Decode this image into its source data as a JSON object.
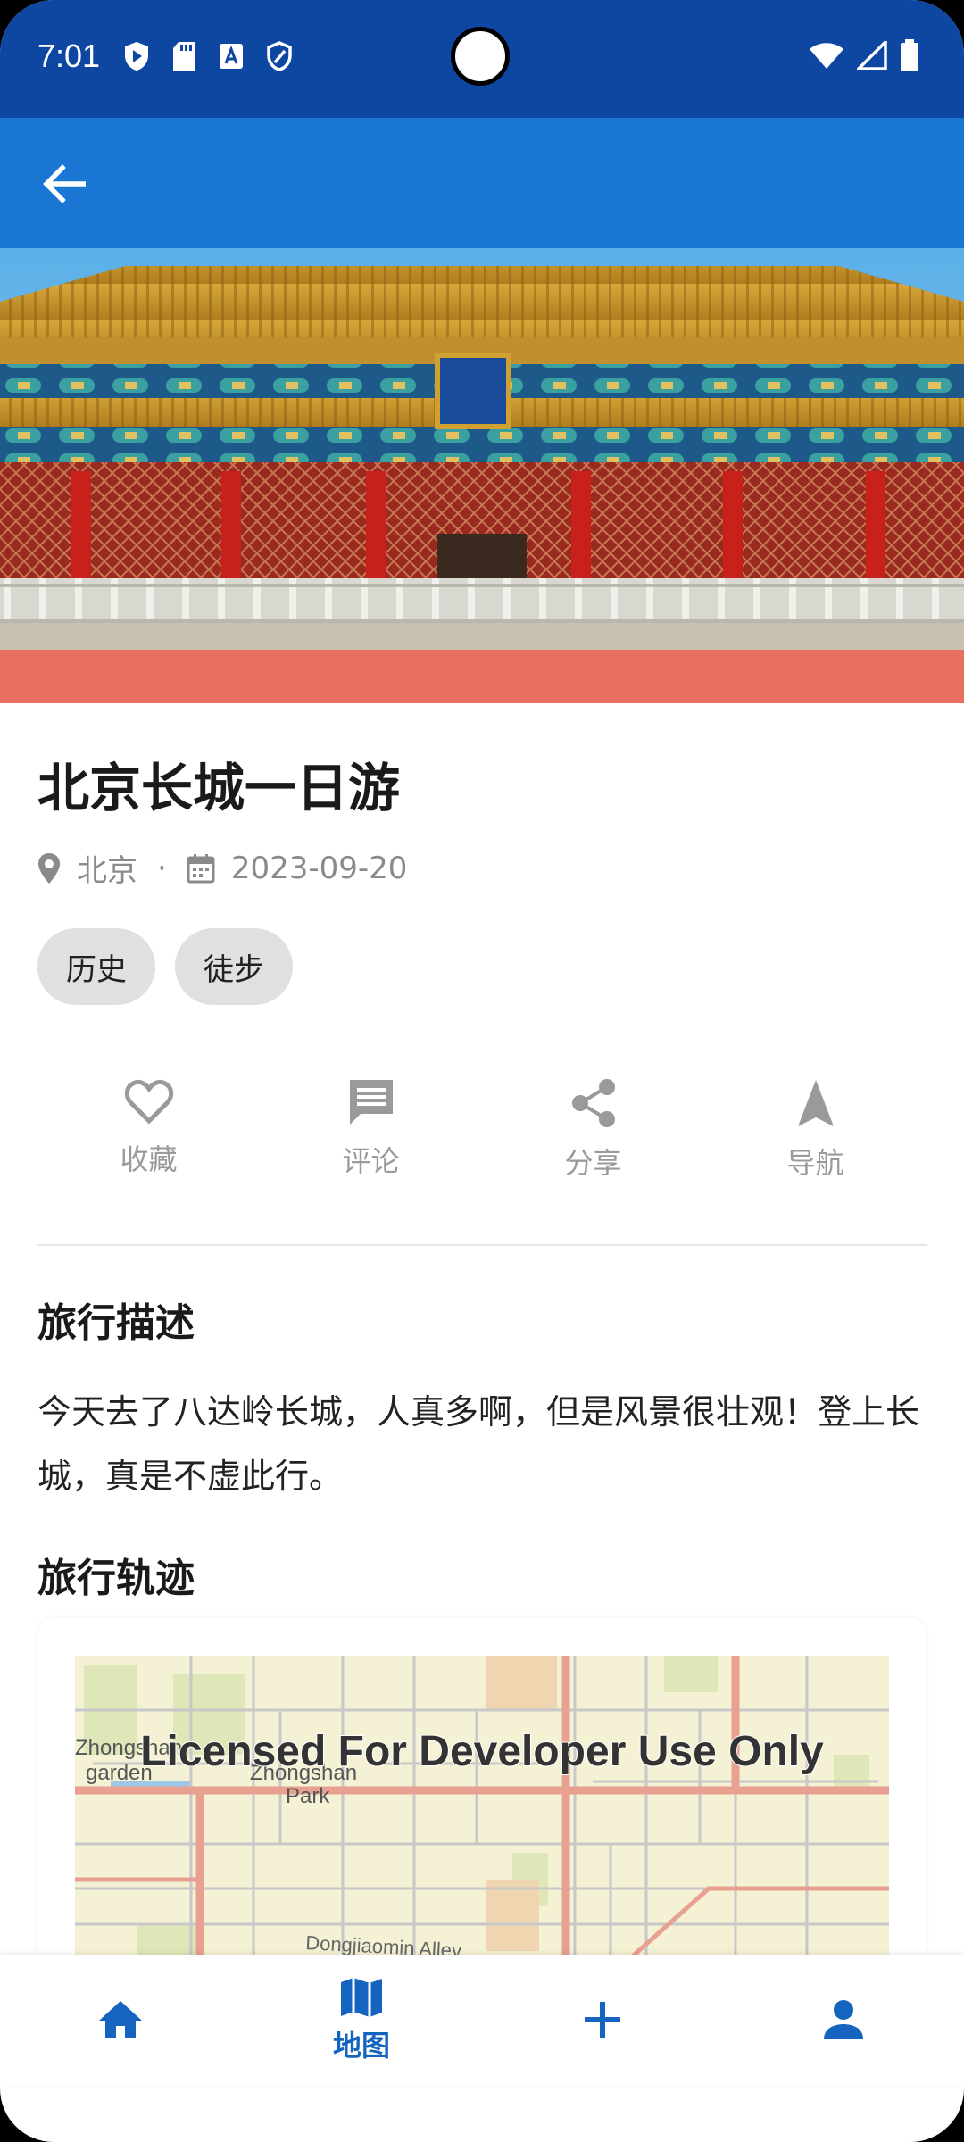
{
  "status_bar": {
    "time": "7:01"
  },
  "app_bar": {
    "back_icon": "arrow-back-icon"
  },
  "hero": {
    "subject": "palace-photo"
  },
  "trip": {
    "title": "北京长城一日游",
    "location": "北京",
    "separator": "·",
    "date": "2023-09-20",
    "tags": [
      "历史",
      "徒步"
    ]
  },
  "actions": [
    {
      "label": "收藏",
      "icon": "heart-icon"
    },
    {
      "label": "评论",
      "icon": "comment-icon"
    },
    {
      "label": "分享",
      "icon": "share-icon"
    },
    {
      "label": "导航",
      "icon": "navigation-icon"
    }
  ],
  "description": {
    "heading": "旅行描述",
    "text": "今天去了八达岭长城，人真多啊，但是风景很壮观！登上长城，真是不虚此行。"
  },
  "track": {
    "heading": "旅行轨迹",
    "watermark": "Licensed For Developer Use Only",
    "place_labels": [
      "Zhongshan",
      "garden",
      "Zhongshan",
      "Park",
      "Dongjiaomin Alley"
    ]
  },
  "bottom_nav": [
    {
      "icon": "home-icon",
      "label": ""
    },
    {
      "icon": "map-icon",
      "label": "地图"
    },
    {
      "icon": "add-icon",
      "label": ""
    },
    {
      "icon": "person-icon",
      "label": ""
    }
  ],
  "colors": {
    "primary": "#1976d2",
    "status": "#0d47a1",
    "accent": "#1565c0"
  }
}
